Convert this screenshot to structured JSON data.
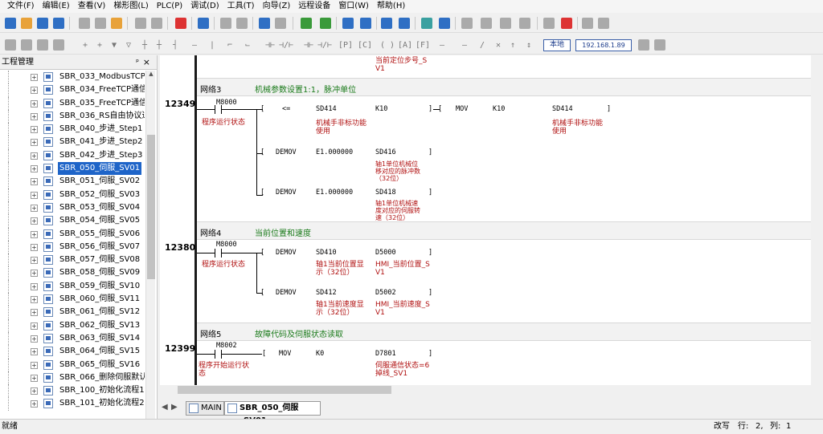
{
  "menu": [
    "文件(F)",
    "编辑(E)",
    "查看(V)",
    "梯形图(L)",
    "PLC(P)",
    "调试(D)",
    "工具(T)",
    "向导(Z)",
    "远程设备",
    "窗口(W)",
    "帮助(H)"
  ],
  "toolbar2": {
    "local_label": "本地",
    "ip_label": "192.168.1.89"
  },
  "panel": {
    "title": "工程管理",
    "pin": "ᵖ",
    "close": "×"
  },
  "tree": [
    {
      "label": "SBR_033_ModbusTCP_"
    },
    {
      "label": "SBR_034_FreeTCP通信"
    },
    {
      "label": "SBR_035_FreeTCP通信2"
    },
    {
      "label": "SBR_036_RS自由协议通"
    },
    {
      "label": "SBR_040_步进_Step1"
    },
    {
      "label": "SBR_041_步进_Step2"
    },
    {
      "label": "SBR_042_步进_Step3"
    },
    {
      "label": "SBR_050_伺服_SV01",
      "selected": true
    },
    {
      "label": "SBR_051_伺服_SV02"
    },
    {
      "label": "SBR_052_伺服_SV03"
    },
    {
      "label": "SBR_053_伺服_SV04"
    },
    {
      "label": "SBR_054_伺服_SV05"
    },
    {
      "label": "SBR_055_伺服_SV06"
    },
    {
      "label": "SBR_056_伺服_SV07"
    },
    {
      "label": "SBR_057_伺服_SV08"
    },
    {
      "label": "SBR_058_伺服_SV09"
    },
    {
      "label": "SBR_059_伺服_SV10"
    },
    {
      "label": "SBR_060_伺服_SV11"
    },
    {
      "label": "SBR_061_伺服_SV12"
    },
    {
      "label": "SBR_062_伺服_SV13"
    },
    {
      "label": "SBR_063_伺服_SV14"
    },
    {
      "label": "SBR_064_伺服_SV15"
    },
    {
      "label": "SBR_065_伺服_SV16"
    },
    {
      "label": "SBR_066_删除伺服默认"
    },
    {
      "label": "SBR_100_初始化流程1"
    },
    {
      "label": "SBR_101_初始化流程2"
    }
  ],
  "ladder": {
    "top_comment": "当前定位步号_S\nV1",
    "net3": {
      "title": "网络3",
      "comment": "机械参数设置1:1，脉冲单位",
      "line": "12349",
      "contact": "M8000",
      "contact_cmt": "程序运行状态",
      "cmp_op": "<=",
      "cmp_a": "SD414",
      "cmp_b": "K10",
      "cmp_a_cmt": "机械手非标功能\n使用",
      "mov": "MOV",
      "mov_src": "K10",
      "mov_dst": "SD414",
      "mov_dst_cmt": "机械手非标功能\n使用",
      "demov1": "DEMOV",
      "demov1_src": "E1.000000",
      "demov1_dst": "SD416",
      "demov1_cmt": "轴1单位机械位\n移对应的脉冲数\n（32位）",
      "demov2": "DEMOV",
      "demov2_src": "E1.000000",
      "demov2_dst": "SD418",
      "demov2_cmt": "轴1单位机械速\n度对应的伺服转\n速（32位）"
    },
    "net4": {
      "title": "网络4",
      "comment": "当前位置和速度",
      "line": "12380",
      "contact": "M8000",
      "contact_cmt": "程序运行状态",
      "i1": "DEMOV",
      "i1_src": "SD410",
      "i1_dst": "D5000",
      "i1_src_cmt": "轴1当前位置显\n示（32位）",
      "i1_dst_cmt": "HMI_当前位置_S\nV1",
      "i2": "DEMOV",
      "i2_src": "SD412",
      "i2_dst": "D5002",
      "i2_src_cmt": "轴1当前速度显\n示（32位）",
      "i2_dst_cmt": "HMI_当前速度_S\nV1"
    },
    "net5": {
      "title": "网络5",
      "comment": "故障代码及伺服状态读取",
      "line": "12399",
      "contact": "M8002",
      "contact_cmt": "程序开始运行状\n态",
      "i1": "MOV",
      "i1_src": "K0",
      "i1_dst": "D7801",
      "i1_dst_cmt": "伺服通信状态=6\n掉线_SV1"
    }
  },
  "tabs": [
    {
      "label": "MAIN"
    },
    {
      "label": "SBR_050_伺服_SV01",
      "active": true
    }
  ],
  "status": {
    "left": "就绪",
    "mode": "改写",
    "row_label": "行:",
    "row": "2,",
    "col_label": "列:",
    "col": "1"
  }
}
